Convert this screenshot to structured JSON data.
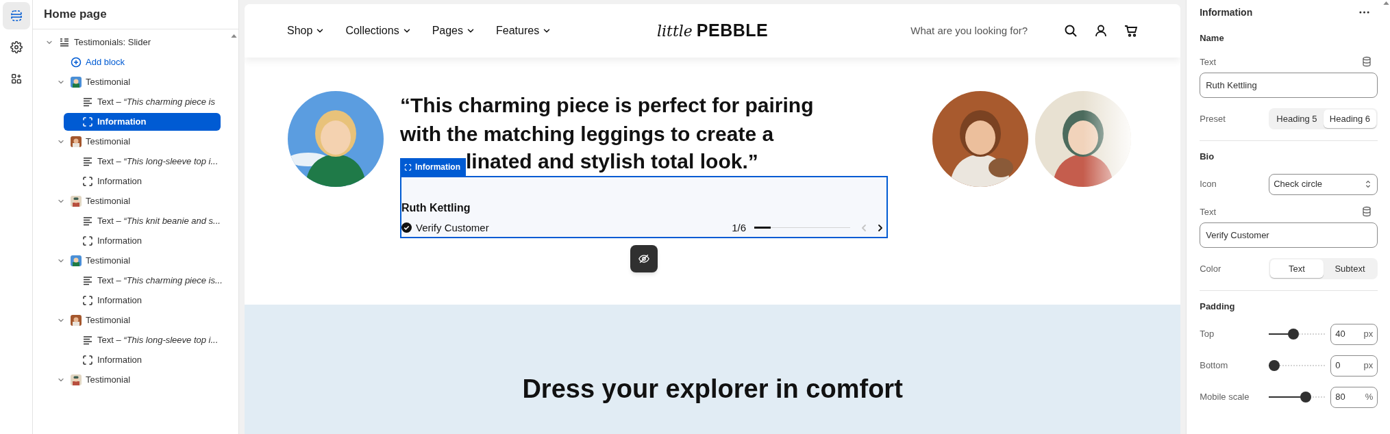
{
  "rail": [
    {
      "selected": true
    },
    {
      "selected": false
    },
    {
      "selected": false
    }
  ],
  "sidebar": {
    "title": "Home page",
    "tree": [
      {
        "kind": "section",
        "label": "Testimonials: Slider",
        "expanded": true,
        "selected": false,
        "children": [
          {
            "kind": "add",
            "label": "Add block",
            "selected": false
          },
          {
            "kind": "block",
            "label": "Testimonial",
            "expanded": true,
            "selected": false,
            "children": [
              {
                "kind": "text",
                "label": "Text – *“This charming piece is*",
                "selected": false
              },
              {
                "kind": "group",
                "label": "Information",
                "selected": true
              }
            ]
          },
          {
            "kind": "block",
            "label": "Testimonial",
            "expanded": true,
            "selected": false,
            "children": [
              {
                "kind": "text",
                "label": "Text – *“This long-sleeve top i...*",
                "selected": false
              },
              {
                "kind": "group",
                "label": "Information",
                "selected": false
              }
            ]
          },
          {
            "kind": "block",
            "label": "Testimonial",
            "expanded": true,
            "selected": false,
            "children": [
              {
                "kind": "text",
                "label": "Text – *“This knit beanie and s...*",
                "selected": false
              },
              {
                "kind": "group",
                "label": "Information",
                "selected": false
              }
            ]
          },
          {
            "kind": "block",
            "label": "Testimonial",
            "expanded": true,
            "selected": false,
            "children": [
              {
                "kind": "text",
                "label": "Text – *“This charming piece is...*",
                "selected": false
              },
              {
                "kind": "group",
                "label": "Information",
                "selected": false
              }
            ]
          },
          {
            "kind": "block",
            "label": "Testimonial",
            "expanded": true,
            "selected": false,
            "children": [
              {
                "kind": "text",
                "label": "Text – *“This long-sleeve top i...*",
                "selected": false
              },
              {
                "kind": "group",
                "label": "Information",
                "selected": false
              }
            ]
          },
          {
            "kind": "block",
            "label": "Testimonial",
            "expanded": true,
            "selected": false
          }
        ]
      }
    ]
  },
  "preview": {
    "nav": {
      "menu": [
        {
          "label": "Shop"
        },
        {
          "label": "Collections"
        },
        {
          "label": "Pages"
        },
        {
          "label": "Features"
        }
      ],
      "logo": {
        "script": "little",
        "wordmark": "PEBBLE"
      },
      "search": {
        "placeholder": "What are you looking for?"
      }
    },
    "testimonial": {
      "quote": [
        "“This charming piece is perfect for pairing",
        "with the matching leggings to create a",
        "linated and stylish total look.”"
      ],
      "info_tag": "Information",
      "name": "Ruth Kettling",
      "bio": "Verify Customer",
      "counter": "1/6",
      "progress": {
        "level": 0.17
      },
      "prev_disabled": true,
      "next_disabled": false
    },
    "section_heading": "Dress your explorer in comfort"
  },
  "settings": {
    "title": "Information",
    "groups": [
      {
        "heading": "Name",
        "fields": [
          {
            "kind": "text",
            "label": "Text",
            "value": "Ruth Kettling"
          },
          {
            "kind": "segmented",
            "label": "Preset",
            "options": [
              {
                "label": "Heading 5",
                "selected": false
              },
              {
                "label": "Heading 6",
                "selected": true
              }
            ]
          }
        ]
      },
      {
        "heading": "Bio",
        "fields": [
          {
            "kind": "select",
            "label": "Icon",
            "value": "Check circle"
          },
          {
            "kind": "text",
            "label": "Text",
            "value": "Verify Customer"
          },
          {
            "kind": "segmented",
            "label": "Color",
            "options": [
              {
                "label": "Text",
                "selected": true
              },
              {
                "label": "Subtext",
                "selected": false
              }
            ]
          }
        ]
      },
      {
        "heading": "Padding",
        "fields": [
          {
            "kind": "slider",
            "label": "Top",
            "level": 0.42,
            "value": "40",
            "unit": "px"
          },
          {
            "kind": "slider",
            "label": "Bottom",
            "level": 0,
            "value": "0",
            "unit": "px"
          },
          {
            "kind": "slider",
            "label": "Mobile scale",
            "level": 0.7,
            "value": "80",
            "unit": "%"
          }
        ]
      }
    ]
  }
}
